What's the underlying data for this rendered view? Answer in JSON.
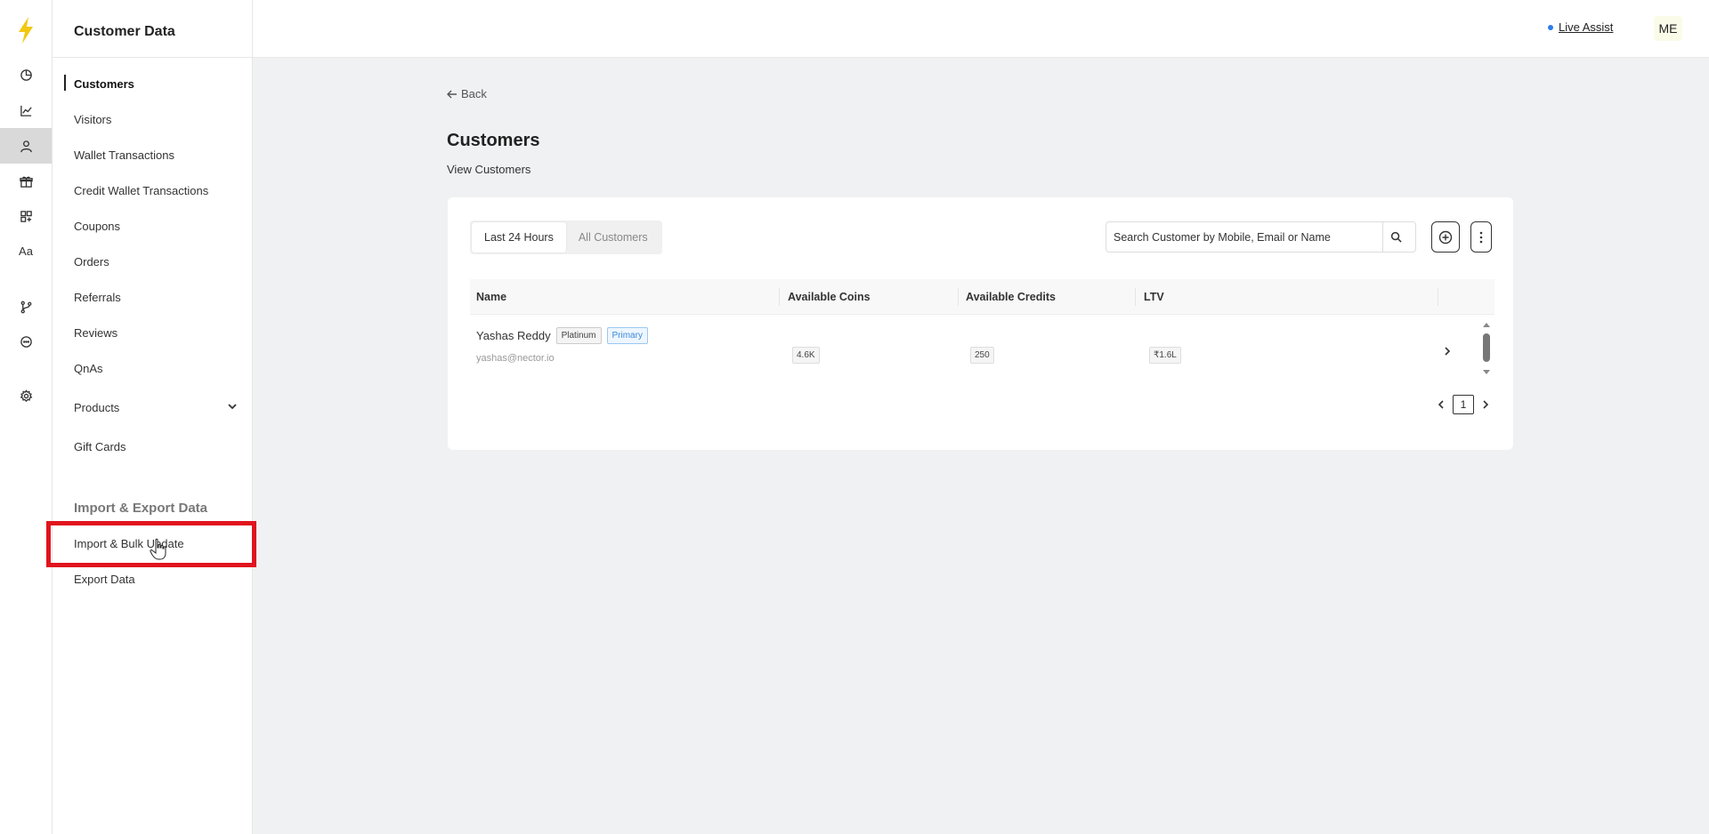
{
  "sidebar": {
    "title": "Customer Data",
    "items": [
      {
        "label": "Customers"
      },
      {
        "label": "Visitors"
      },
      {
        "label": "Wallet Transactions"
      },
      {
        "label": "Credit Wallet Transactions"
      },
      {
        "label": "Coupons"
      },
      {
        "label": "Orders"
      },
      {
        "label": "Referrals"
      },
      {
        "label": "Reviews"
      },
      {
        "label": "QnAs"
      },
      {
        "label": "Products"
      },
      {
        "label": "Gift Cards"
      }
    ],
    "section_title": "Import & Export Data",
    "section_items": [
      {
        "label": "Import & Bulk Update"
      },
      {
        "label": "Export Data"
      }
    ]
  },
  "rail": {
    "icons": [
      "logo-bolt-icon",
      "dashboard-icon",
      "analytics-icon",
      "customer-icon",
      "gift-icon",
      "widgets-icon",
      "text-icon",
      "branch-icon",
      "chat-icon",
      "settings-icon"
    ],
    "text_icon_label": "Aa"
  },
  "topbar": {
    "live_assist": "Live Assist",
    "avatar": "ME"
  },
  "main": {
    "back": "Back",
    "title": "Customers",
    "subtitle": "View Customers",
    "tabs": [
      {
        "label": "Last 24 Hours"
      },
      {
        "label": "All Customers"
      }
    ],
    "search": {
      "placeholder": "Search Customer by Mobile, Email or Name",
      "value": ""
    },
    "table": {
      "columns": [
        "Name",
        "Available Coins",
        "Available Credits",
        "LTV"
      ],
      "rows": [
        {
          "name": "Yashas Reddy",
          "badges": [
            "Platinum",
            "Primary"
          ],
          "email": "yashas@nector.io",
          "coins": "4.6K",
          "credits": "250",
          "ltv": "₹1.6L"
        }
      ]
    },
    "pagination": {
      "page": "1"
    }
  },
  "colors": {
    "accent_yellow": "#f2c811",
    "highlight_red": "#e0141e",
    "live_dot": "#2b7de9"
  }
}
